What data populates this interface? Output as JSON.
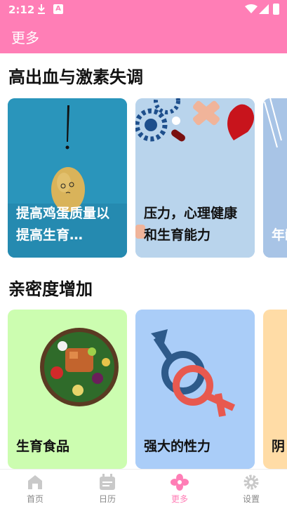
{
  "status": {
    "time": "2:12"
  },
  "appbar": {
    "title": "更多"
  },
  "sections": [
    {
      "title": "高出血与激素失调",
      "cards": [
        {
          "label": "提高鸡蛋质量以提高生育…"
        },
        {
          "label": "压力，心理健康和生育能力"
        },
        {
          "label": "年龄力"
        }
      ]
    },
    {
      "title": "亲密度增加",
      "cards": [
        {
          "label": "生育食品"
        },
        {
          "label": "强大的性力"
        },
        {
          "label": "阴"
        }
      ]
    }
  ],
  "nav": [
    {
      "label": "首页",
      "icon": "home-icon"
    },
    {
      "label": "日历",
      "icon": "calendar-icon"
    },
    {
      "label": "更多",
      "icon": "flower-icon",
      "active": true
    },
    {
      "label": "设置",
      "icon": "gear-icon"
    }
  ],
  "colors": {
    "accent": "#ff7eb6",
    "inactive": "#888888"
  }
}
